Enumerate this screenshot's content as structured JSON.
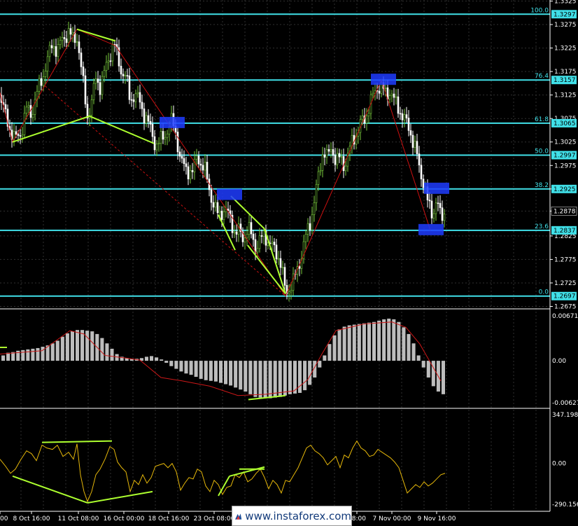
{
  "chart_data": {
    "type": "candlestick",
    "instrument_panel": {
      "ylim": [
        1.2675,
        1.3325
      ],
      "price_ticks": [
        "1.3325",
        "1.3275",
        "1.3225",
        "1.3175",
        "1.3125",
        "1.3075",
        "1.3025",
        "1.2975",
        "1.2925",
        "1.2878",
        "1.2825",
        "1.2775",
        "1.2725",
        "1.2675"
      ],
      "fib_levels": [
        {
          "ratio": "100.0",
          "price": 1.3297,
          "label": "1.3297"
        },
        {
          "ratio": "76.4",
          "price": 1.3157,
          "label": "1.3157"
        },
        {
          "ratio": "61.8",
          "price": 1.3065,
          "label": "1.3065"
        },
        {
          "ratio": "50.0",
          "price": 1.2997,
          "label": "1.2997"
        },
        {
          "ratio": "38.2",
          "price": 1.2925,
          "label": "1.2925"
        },
        {
          "ratio": "23.6",
          "price": 1.2837,
          "label": "1.2837"
        },
        {
          "ratio": "0.0",
          "price": 1.2697,
          "label": "1.2697"
        }
      ],
      "current_price": "1.2878",
      "close_path": [
        [
          0,
          1.3125
        ],
        [
          8,
          1.308
        ],
        [
          15,
          1.305
        ],
        [
          22,
          1.303
        ],
        [
          30,
          1.3045
        ],
        [
          38,
          1.3095
        ],
        [
          45,
          1.3085
        ],
        [
          52,
          1.3125
        ],
        [
          60,
          1.316
        ],
        [
          67,
          1.3195
        ],
        [
          75,
          1.3235
        ],
        [
          82,
          1.322
        ],
        [
          90,
          1.3245
        ],
        [
          98,
          1.326
        ],
        [
          105,
          1.324
        ],
        [
          110,
          1.325
        ],
        [
          115,
          1.3195
        ],
        [
          120,
          1.3135
        ],
        [
          125,
          1.308
        ],
        [
          131,
          1.311
        ],
        [
          137,
          1.316
        ],
        [
          143,
          1.3145
        ],
        [
          150,
          1.3175
        ],
        [
          157,
          1.321
        ],
        [
          163,
          1.324
        ],
        [
          168,
          1.32
        ],
        [
          174,
          1.3175
        ],
        [
          180,
          1.3165
        ],
        [
          186,
          1.311
        ],
        [
          192,
          1.313
        ],
        [
          198,
          1.3115
        ],
        [
          204,
          1.309
        ],
        [
          210,
          1.3075
        ],
        [
          216,
          1.3045
        ],
        [
          222,
          1.302
        ],
        [
          228,
          1.3025
        ],
        [
          234,
          1.3035
        ],
        [
          240,
          1.3055
        ],
        [
          246,
          1.307
        ],
        [
          252,
          1.304
        ],
        [
          258,
          1.2985
        ],
        [
          264,
          1.297
        ],
        [
          270,
          1.2965
        ],
        [
          276,
          1.296
        ],
        [
          282,
          1.3
        ],
        [
          288,
          1.2975
        ],
        [
          294,
          1.296
        ],
        [
          300,
          1.292
        ],
        [
          306,
          1.2885
        ],
        [
          312,
          1.287
        ],
        [
          318,
          1.288
        ],
        [
          324,
          1.2875
        ],
        [
          330,
          1.286
        ],
        [
          336,
          1.283
        ],
        [
          342,
          1.2835
        ],
        [
          348,
          1.282
        ],
        [
          354,
          1.284
        ],
        [
          360,
          1.2825
        ],
        [
          366,
          1.28
        ],
        [
          372,
          1.2815
        ],
        [
          378,
          1.283
        ],
        [
          384,
          1.281
        ],
        [
          390,
          1.28
        ],
        [
          396,
          1.279
        ],
        [
          402,
          1.276
        ],
        [
          408,
          1.2705
        ],
        [
          414,
          1.2715
        ],
        [
          420,
          1.273
        ],
        [
          426,
          1.276
        ],
        [
          432,
          1.279
        ],
        [
          438,
          1.283
        ],
        [
          444,
          1.286
        ],
        [
          450,
          1.2905
        ],
        [
          456,
          1.296
        ],
        [
          462,
          1.301
        ],
        [
          468,
          1.299
        ],
        [
          474,
          1.3015
        ],
        [
          480,
          1.2985
        ],
        [
          486,
          1.299
        ],
        [
          492,
          1.2975
        ],
        [
          498,
          1.3
        ],
        [
          504,
          1.303
        ],
        [
          510,
          1.3045
        ],
        [
          516,
          1.3065
        ],
        [
          522,
          1.3075
        ],
        [
          528,
          1.3105
        ],
        [
          534,
          1.3125
        ],
        [
          540,
          1.3145
        ],
        [
          546,
          1.314
        ],
        [
          552,
          1.3125
        ],
        [
          558,
          1.3135
        ],
        [
          564,
          1.311
        ],
        [
          570,
          1.3095
        ],
        [
          576,
          1.308
        ],
        [
          582,
          1.306
        ],
        [
          588,
          1.304
        ],
        [
          594,
          1.301
        ],
        [
          600,
          1.296
        ],
        [
          606,
          1.294
        ],
        [
          612,
          1.289
        ],
        [
          618,
          1.287
        ],
        [
          624,
          1.2905
        ],
        [
          630,
          1.286
        ],
        [
          636,
          1.2878
        ]
      ],
      "zigzag": [
        [
          0,
          1.313
        ],
        [
          18,
          1.3025
        ],
        [
          110,
          1.3265
        ],
        [
          165,
          1.323
        ],
        [
          408,
          1.2697
        ],
        [
          545,
          1.3157
        ],
        [
          615,
          1.2837
        ]
      ],
      "fib_dashed_line": [
        [
          60,
          1.315
        ],
        [
          408,
          1.2697
        ]
      ],
      "divergence_lines_price": [
        [
          [
            18,
            1.3025
          ],
          [
            128,
            1.308
          ]
        ],
        [
          [
            110,
            1.3265
          ],
          [
            165,
            1.324
          ]
        ],
        [
          [
            128,
            1.308
          ],
          [
            220,
            1.3022
          ]
        ],
        [
          [
            312,
            1.287
          ],
          [
            336,
            1.2795
          ]
        ],
        [
          [
            330,
            1.291
          ],
          [
            378,
            1.284
          ]
        ],
        [
          [
            354,
            1.2805
          ],
          [
            408,
            1.2702
          ]
        ],
        [
          [
            378,
            1.284
          ],
          [
            408,
            1.2702
          ]
        ]
      ],
      "highlight_boxes": [
        {
          "x": 246,
          "price": 1.3065
        },
        {
          "x": 328,
          "price": 1.2912
        },
        {
          "x": 548,
          "price": 1.3157
        },
        {
          "x": 624,
          "price": 1.2925
        },
        {
          "x": 616,
          "price": 1.2837
        }
      ]
    },
    "macd_panel": {
      "ylim": [
        -0.00627,
        0.00671
      ],
      "ticks": [
        "0.00671",
        "0.00",
        "-0.00627"
      ],
      "histogram": [
        0.0008,
        0.0012,
        0.0013,
        0.0015,
        0.0016,
        0.0017,
        0.0018,
        0.0019,
        0.0021,
        0.0023,
        0.0026,
        0.003,
        0.0036,
        0.0041,
        0.0044,
        0.0046,
        0.0046,
        0.0045,
        0.0044,
        0.004,
        0.0034,
        0.0026,
        0.0018,
        0.001,
        0.0006,
        0.0004,
        0.0003,
        0.0003,
        0.0004,
        0.0006,
        0.0007,
        0.0005,
        0.0002,
        -0.0003,
        -0.0008,
        -0.0012,
        -0.0016,
        -0.0019,
        -0.0021,
        -0.0024,
        -0.0027,
        -0.0029,
        -0.003,
        -0.0031,
        -0.0033,
        -0.0035,
        -0.0037,
        -0.004,
        -0.0043,
        -0.0046,
        -0.005,
        -0.0054,
        -0.0055,
        -0.0056,
        -0.0056,
        -0.0055,
        -0.0054,
        -0.0052,
        -0.005,
        -0.0049,
        -0.0048,
        -0.0044,
        -0.0036,
        -0.0025,
        -0.001,
        0.0008,
        0.0025,
        0.0038,
        0.0047,
        0.0051,
        0.0053,
        0.0054,
        0.0055,
        0.0056,
        0.0057,
        0.0058,
        0.006,
        0.0062,
        0.0063,
        0.0062,
        0.0058,
        0.005,
        0.004,
        0.0026,
        0.0008,
        -0.001,
        -0.0025,
        -0.0038,
        -0.0046,
        -0.005
      ],
      "signal": [
        [
          0,
          0.001
        ],
        [
          60,
          0.0015
        ],
        [
          100,
          0.0045
        ],
        [
          120,
          0.004
        ],
        [
          150,
          0.0008
        ],
        [
          180,
          0.0004
        ],
        [
          200,
          0.0001
        ],
        [
          230,
          -0.0025
        ],
        [
          260,
          -0.003
        ],
        [
          300,
          -0.0038
        ],
        [
          340,
          -0.0052
        ],
        [
          380,
          -0.005
        ],
        [
          420,
          -0.0045
        ],
        [
          440,
          -0.0028
        ],
        [
          460,
          0.001
        ],
        [
          480,
          0.0045
        ],
        [
          520,
          0.0055
        ],
        [
          560,
          0.0058
        ],
        [
          580,
          0.005
        ],
        [
          600,
          0.0025
        ],
        [
          630,
          -0.003
        ]
      ],
      "divergence_lines": [
        [
          [
            0,
            0.002
          ],
          [
            10,
            0.002
          ]
        ],
        [
          [
            355,
            -0.0058
          ],
          [
            408,
            -0.0052
          ]
        ]
      ]
    },
    "oscillator_panel": {
      "ylim": [
        -290.156,
        347.1984
      ],
      "ticks": [
        "347.1984",
        "0.00",
        "-290.156"
      ],
      "line": [
        [
          0,
          30
        ],
        [
          8,
          -20
        ],
        [
          15,
          -70
        ],
        [
          22,
          -40
        ],
        [
          30,
          30
        ],
        [
          38,
          90
        ],
        [
          45,
          70
        ],
        [
          52,
          20
        ],
        [
          60,
          130
        ],
        [
          67,
          110
        ],
        [
          75,
          100
        ],
        [
          82,
          130
        ],
        [
          90,
          50
        ],
        [
          98,
          80
        ],
        [
          105,
          30
        ],
        [
          110,
          140
        ],
        [
          115,
          -80
        ],
        [
          120,
          -200
        ],
        [
          125,
          -270
        ],
        [
          131,
          -200
        ],
        [
          137,
          -80
        ],
        [
          143,
          -40
        ],
        [
          150,
          30
        ],
        [
          157,
          120
        ],
        [
          163,
          100
        ],
        [
          168,
          10
        ],
        [
          174,
          -30
        ],
        [
          180,
          -60
        ],
        [
          186,
          -200
        ],
        [
          192,
          -120
        ],
        [
          198,
          -150
        ],
        [
          204,
          -80
        ],
        [
          210,
          -140
        ],
        [
          216,
          -100
        ],
        [
          222,
          -20
        ],
        [
          228,
          -10
        ],
        [
          234,
          0
        ],
        [
          240,
          -30
        ],
        [
          246,
          0
        ],
        [
          252,
          -60
        ],
        [
          258,
          -190
        ],
        [
          264,
          -140
        ],
        [
          270,
          -100
        ],
        [
          276,
          -110
        ],
        [
          282,
          -40
        ],
        [
          288,
          -60
        ],
        [
          294,
          -160
        ],
        [
          300,
          -200
        ],
        [
          306,
          -120
        ],
        [
          312,
          -150
        ],
        [
          318,
          -220
        ],
        [
          324,
          -170
        ],
        [
          330,
          -160
        ],
        [
          336,
          -80
        ],
        [
          342,
          -100
        ],
        [
          348,
          -60
        ],
        [
          354,
          -130
        ],
        [
          360,
          -110
        ],
        [
          366,
          -70
        ],
        [
          372,
          -40
        ],
        [
          378,
          -100
        ],
        [
          384,
          -180
        ],
        [
          390,
          -120
        ],
        [
          396,
          -150
        ],
        [
          402,
          -210
        ],
        [
          408,
          -120
        ],
        [
          414,
          -130
        ],
        [
          420,
          -80
        ],
        [
          426,
          -30
        ],
        [
          432,
          40
        ],
        [
          438,
          110
        ],
        [
          444,
          130
        ],
        [
          450,
          90
        ],
        [
          456,
          70
        ],
        [
          462,
          40
        ],
        [
          468,
          -10
        ],
        [
          474,
          20
        ],
        [
          480,
          50
        ],
        [
          486,
          -30
        ],
        [
          492,
          60
        ],
        [
          498,
          40
        ],
        [
          504,
          110
        ],
        [
          510,
          160
        ],
        [
          516,
          110
        ],
        [
          522,
          90
        ],
        [
          528,
          50
        ],
        [
          534,
          60
        ],
        [
          540,
          100
        ],
        [
          546,
          80
        ],
        [
          552,
          60
        ],
        [
          558,
          40
        ],
        [
          564,
          10
        ],
        [
          570,
          -30
        ],
        [
          576,
          -120
        ],
        [
          582,
          -210
        ],
        [
          588,
          -180
        ],
        [
          594,
          -150
        ],
        [
          600,
          -170
        ],
        [
          606,
          -130
        ],
        [
          612,
          -160
        ],
        [
          618,
          -140
        ],
        [
          624,
          -110
        ],
        [
          630,
          -80
        ],
        [
          636,
          -70
        ]
      ],
      "divergence_lines": [
        [
          [
            18,
            -90
          ],
          [
            125,
            -280
          ]
        ],
        [
          [
            60,
            150
          ],
          [
            160,
            160
          ]
        ],
        [
          [
            125,
            -280
          ],
          [
            218,
            -200
          ]
        ],
        [
          [
            312,
            -230
          ],
          [
            328,
            -90
          ]
        ],
        [
          [
            328,
            -90
          ],
          [
            378,
            -25
          ]
        ],
        [
          [
            342,
            -40
          ],
          [
            378,
            -40
          ]
        ]
      ]
    },
    "x_labels": [
      {
        "x": 0,
        "label": "00"
      },
      {
        "x": 45,
        "label": "8 Oct 16:00"
      },
      {
        "x": 112,
        "label": "11 Oct 08:00"
      },
      {
        "x": 177,
        "label": "16 Oct 00:00"
      },
      {
        "x": 241,
        "label": "18 Oct 16:00"
      },
      {
        "x": 306,
        "label": "23 Oct 08:00"
      },
      {
        "x": 510,
        "label": "08:00"
      },
      {
        "x": 560,
        "label": "7 Nov 00:00"
      },
      {
        "x": 624,
        "label": "9 Nov 16:00"
      }
    ]
  },
  "watermark": {
    "text": "www.instaforex.com"
  },
  "colors": {
    "background": "#000000",
    "grid": "#303030",
    "bull_candle": "#78c83c",
    "bear_candle": "#ffffff",
    "fib_line": "#40e0e8",
    "zigzag": "#cc1010",
    "divergence": "#adff2f",
    "highlight": "#1e3cff",
    "histogram": "#bdbdbd",
    "oscillator": "#e5b70a",
    "text": "#ffffff"
  }
}
